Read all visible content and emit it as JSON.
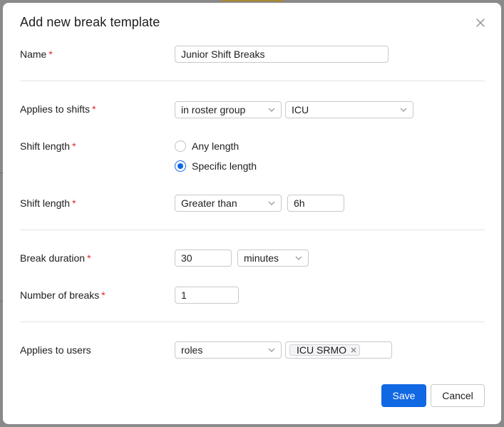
{
  "modal": {
    "title": "Add new break template"
  },
  "form": {
    "name": {
      "label": "Name",
      "value": "Junior Shift Breaks"
    },
    "applies_to_shifts": {
      "label": "Applies to shifts",
      "mode": "in roster group",
      "group": "ICU"
    },
    "shift_length_mode": {
      "label": "Shift length",
      "options": [
        "Any length",
        "Specific length"
      ],
      "selected": "Specific length"
    },
    "shift_length_value": {
      "label": "Shift length",
      "comparator": "Greater than",
      "value": "6h"
    },
    "break_duration": {
      "label": "Break duration",
      "value": "30",
      "unit": "minutes"
    },
    "number_of_breaks": {
      "label": "Number of breaks",
      "value": "1"
    },
    "applies_to_users": {
      "label": "Applies to users",
      "mode": "roles",
      "tags": [
        "ICU SRMO"
      ]
    },
    "required_marker": "*"
  },
  "actions": {
    "save_label": "Save",
    "cancel_label": "Cancel"
  },
  "colors": {
    "accent": "#1168e3",
    "required": "#e0242b",
    "border": "#c9c9cc",
    "divider": "#e4e4e6"
  }
}
